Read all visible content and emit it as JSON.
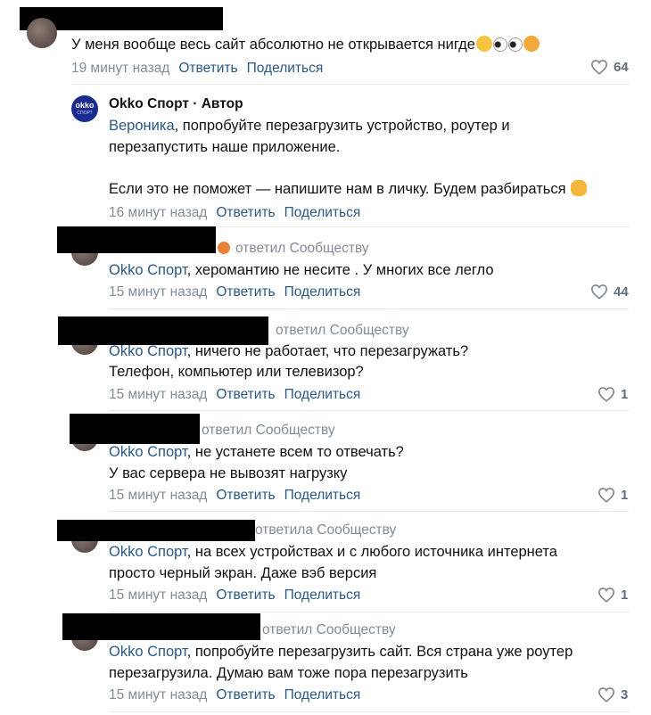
{
  "comments": [
    {
      "text": "У меня вообще весь сайт абсолютно не открывается нигде",
      "time": "19 минут назад",
      "reply": "Ответить",
      "share": "Поделиться",
      "likes": "64"
    },
    {
      "author": "Okko Спорт · Автор",
      "mention": "Вероника",
      "line1": ", попробуйте перезагрузить устройство, роутер и",
      "line2": "перезапустить наше приложение.",
      "line3": "Если это не поможет — напишите нам в личку. Будем разбираться",
      "time": "16 минут назад",
      "reply": "Ответить",
      "share": "Поделиться"
    },
    {
      "replied_to": "ответил Сообществу",
      "mention": "Okko Спорт",
      "line1": ", херомантию не несите . У многих все легло",
      "time": "15 минут назад",
      "reply": "Ответить",
      "share": "Поделиться",
      "likes": "44"
    },
    {
      "replied_to": "ответил Сообществу",
      "mention": "Okko Спорт",
      "line1": ", ничего не работает, что перезагружать?",
      "line2": "Телефон, компьютер или телевизор?",
      "time": "15 минут назад",
      "reply": "Ответить",
      "share": "Поделиться",
      "likes": "1"
    },
    {
      "replied_to": "ответил Сообществу",
      "mention": "Okko Спорт",
      "line1": ", не устанете всем то отвечать?",
      "line2": "У вас сервера не вывозят нагрузку",
      "time": "15 минут назад",
      "reply": "Ответить",
      "share": "Поделиться",
      "likes": "1"
    },
    {
      "replied_to": "ответила Сообществу",
      "mention": "Okko Спорт",
      "line1": ", на всех устройствах и с любого источника интернета",
      "line2": "просто черный экран. Даже вэб версия",
      "time": "15 минут назад",
      "reply": "Ответить",
      "share": "Поделиться",
      "likes": "1"
    },
    {
      "replied_to": "ответил Сообществу",
      "mention": "Okko Спорт",
      "line1": ", попробуйте перезагрузить сайт. Вся страна уже роутер",
      "line2": "перезагрузила. Думаю вам тоже пора перезагрузить",
      "time": "15 минут назад",
      "reply": "Ответить",
      "share": "Поделиться",
      "likes": "3"
    }
  ],
  "logo": {
    "top": "okko",
    "bottom": "СПОРТ"
  },
  "colors": {
    "link": "#2a5885",
    "meta": "#818c99",
    "redaction": "#000000"
  },
  "icons": [
    "heart-icon",
    "emoji-flushed",
    "emoji-eyes",
    "emoji-scream",
    "emoji-ok-hand"
  ]
}
